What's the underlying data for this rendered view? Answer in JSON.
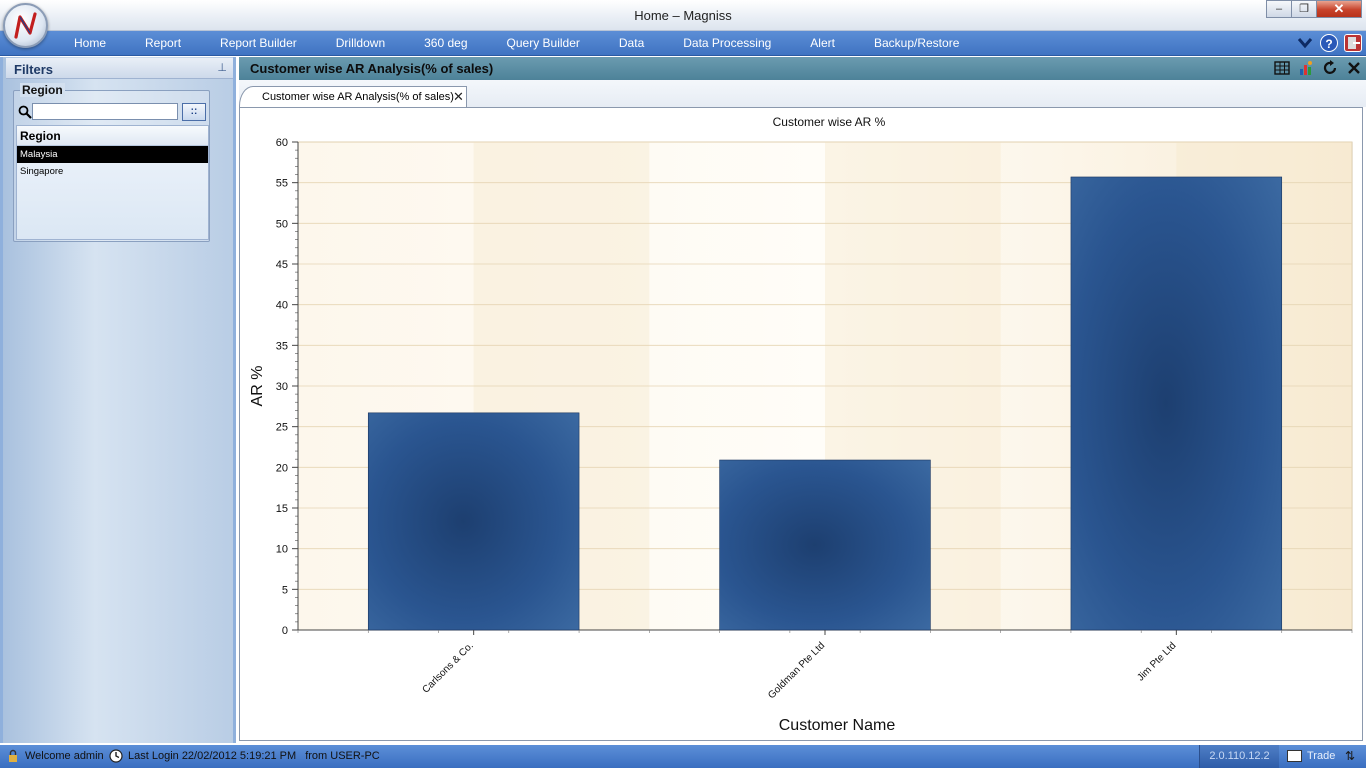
{
  "window": {
    "title": "Home – Magniss",
    "minimize_label": "–",
    "maximize_label": "❐",
    "close_label": "✕"
  },
  "menu": {
    "items": [
      "Home",
      "Report",
      "Report Builder",
      "Drilldown",
      "360 deg",
      "Query Builder",
      "Data",
      "Data Processing",
      "Alert",
      "Backup/Restore"
    ],
    "right_icons": [
      "chevron-down-icon",
      "help-icon",
      "exit-icon"
    ],
    "help_label": "?"
  },
  "filters": {
    "title": "Filters",
    "pin_label": "⊥",
    "region_group_label": "Region",
    "search_placeholder": "",
    "search_button_label": "::",
    "list_header": "Region",
    "items": [
      {
        "label": "Malaysia",
        "selected": true
      },
      {
        "label": "Singapore",
        "selected": false
      }
    ]
  },
  "main": {
    "title": "Customer wise AR Analysis(% of sales)",
    "toolbar_icons": [
      "grid-icon",
      "chart-settings-icon",
      "refresh-icon",
      "close-icon"
    ],
    "tab_label": "Customer wise AR Analysis(% of sales)",
    "tab_close_label": "✕"
  },
  "chart_data": {
    "type": "bar",
    "title": "Customer wise AR %",
    "xlabel": "Customer Name",
    "ylabel": "AR %",
    "categories": [
      "Carlsons & Co.",
      "Goldman Pte Ltd",
      "Jim Pte Ltd"
    ],
    "values": [
      26.7,
      20.9,
      55.7
    ],
    "ylim": [
      0,
      60
    ],
    "yticks": [
      0,
      5,
      10,
      15,
      20,
      25,
      30,
      35,
      40,
      45,
      50,
      55,
      60
    ],
    "grid": true,
    "bar_color": "#2a5590",
    "background_color": "#fbf3e4"
  },
  "status": {
    "welcome": "Welcome admin",
    "last_login": "Last Login 22/02/2012 5:19:21 PM",
    "from": "from USER-PC",
    "version": "2.0.110.12.2",
    "trade": "Trade"
  }
}
